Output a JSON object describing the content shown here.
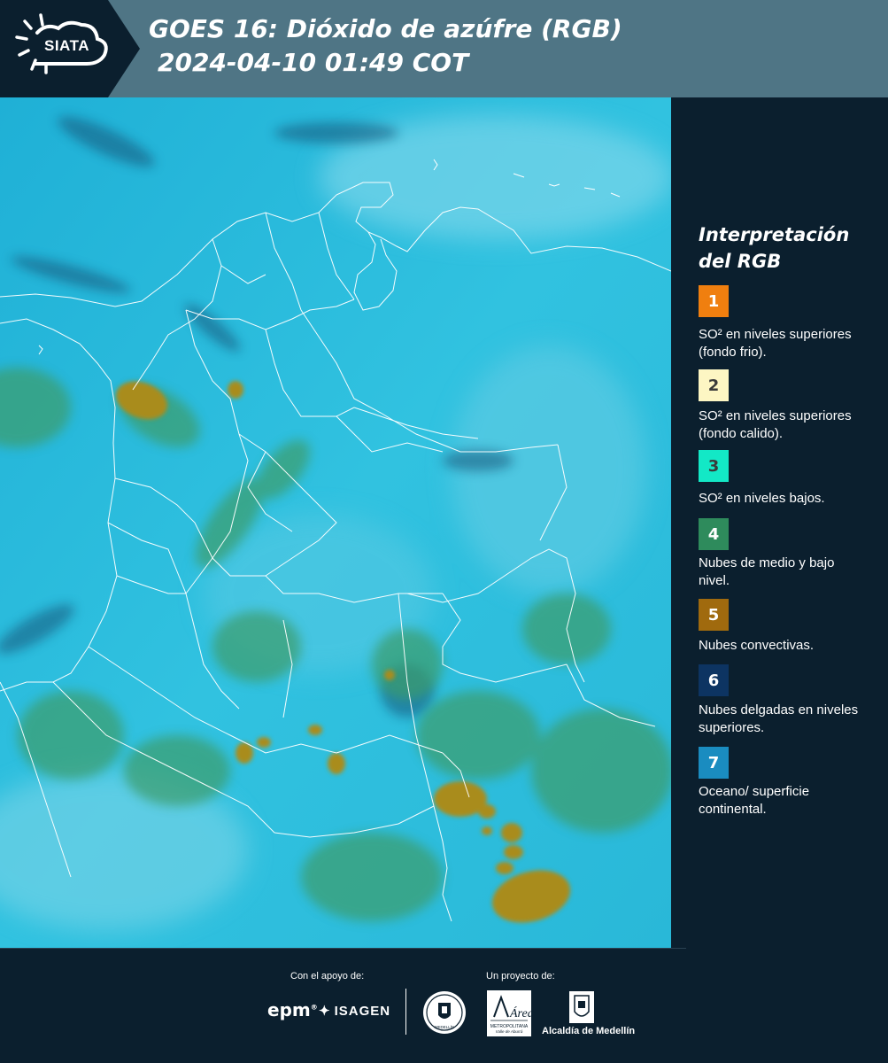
{
  "header": {
    "logo_text": "SIATA",
    "title_line1": "GOES 16: Dióxido de azúfre (RGB)",
    "title_line2": "2024-04-10 01:49 COT",
    "color": "#4f7585"
  },
  "legend": {
    "title_line1": "Interpretación",
    "title_line2": "del RGB",
    "items": [
      {
        "number": "1",
        "color": "#f07f0f",
        "label": "SO² en niveles superiores (fondo frio)."
      },
      {
        "number": "2",
        "color": "#fdf6c3",
        "label": "SO² en niveles superiores (fondo calido)."
      },
      {
        "number": "3",
        "color": "#13e8c6",
        "label": "SO² en niveles bajos."
      },
      {
        "number": "4",
        "color": "#2e8b5c",
        "label": "Nubes de medio y bajo nivel."
      },
      {
        "number": "5",
        "color": "#a06a0e",
        "label": "Nubes convectivas."
      },
      {
        "number": "6",
        "color": "#0d3462",
        "label": "Nubes delgadas en niveles superiores."
      },
      {
        "number": "7",
        "color": "#1a8cc0",
        "label": "Oceano/ superficie continental."
      }
    ]
  },
  "footer": {
    "support_label": "Con el apoyo de:",
    "project_label": "Un proyecto de:",
    "epm_logo": "epm",
    "isagen_logo": "ISAGEN",
    "area_logo": "Área",
    "area_subtitle": "METROPOLITANA",
    "area_subtitle2": "Valle de Aburrá",
    "alcaldia_logo": "Alcaldía de Medellín",
    "seal_text": "MEDELLÍN"
  },
  "map": {
    "ocean_color": "#25b8d8",
    "convective_color": "#a88a1e",
    "border_color": "#ffffff"
  }
}
